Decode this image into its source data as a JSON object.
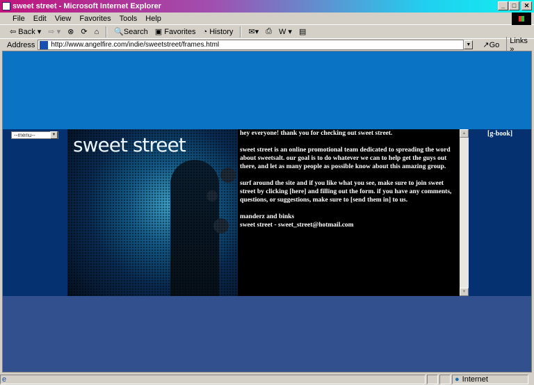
{
  "window": {
    "title": "sweet street - Microsoft Internet Explorer"
  },
  "menubar": [
    "File",
    "Edit",
    "View",
    "Favorites",
    "Tools",
    "Help"
  ],
  "toolbar": {
    "back": "Back",
    "search": "Search",
    "favorites": "Favorites",
    "history": "History"
  },
  "address": {
    "label": "Address",
    "url": "http://www.angelfire.com/indie/sweetstreet/frames.html",
    "go": "Go",
    "links": "Links"
  },
  "page": {
    "menu_select": "--menu--",
    "logo": "sweet street",
    "paragraphs": [
      "hey everyone! thank you for checking out sweet street.",
      "sweet street is an online promotional team dedicated to spreading the word about sweetsalt. our goal is to do whatever we can to help get the guys out there, and let as many people as possible know about this amazing group.",
      "surf around the site and if you like what you see, make sure to join sweet street by clicking [here] and filling out the form. if you have any comments, questions, or suggestions, make sure to [send them in] to us."
    ],
    "signature": "manderz and binks",
    "contact": "sweet street - sweet_street@hotmail.com",
    "gbook": "[g-book]"
  },
  "status": {
    "zone": "Internet"
  },
  "colors": {
    "top": "#0a73c4",
    "middle": "#053170",
    "bottom": "#324f8e"
  }
}
